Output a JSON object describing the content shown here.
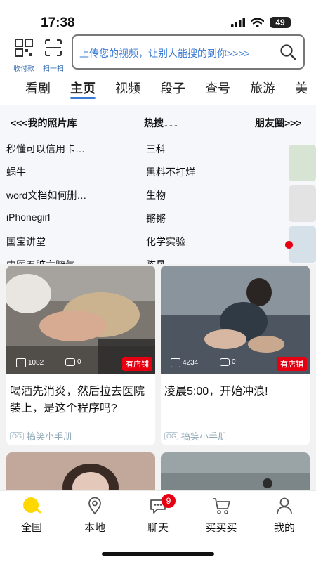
{
  "status_bar": {
    "time": "17:38",
    "battery": "49"
  },
  "top_bar": {
    "receive_pay_label": "收付款",
    "scan_label": "扫一扫",
    "search_placeholder": "上传您的视频，让别人能搜的到你>>>>"
  },
  "tabs": [
    {
      "label": "看剧",
      "active": false
    },
    {
      "label": "主页",
      "active": true
    },
    {
      "label": "视频",
      "active": false
    },
    {
      "label": "段子",
      "active": false
    },
    {
      "label": "查号",
      "active": false
    },
    {
      "label": "旅游",
      "active": false
    },
    {
      "label": "美",
      "active": false
    }
  ],
  "hot_section": {
    "left_head": "<<<我的照片库",
    "center_head": "热搜↓↓↓",
    "right_head": "朋友圈>>>",
    "left_items": [
      "秒懂可以信用卡…",
      "蜗牛",
      "word文档如何删…",
      "iPhonegirl",
      "国宝讲堂",
      "中医五脏六腑气…"
    ],
    "right_items": [
      "三科",
      "黑料不打烊",
      "生物",
      "锵锵",
      "化学实验",
      "陈垦"
    ]
  },
  "cards": [
    {
      "likes": "1082",
      "comments": "0",
      "badge": "有店铺",
      "title": "喝酒先消炎，然后拉去医院装上，是这个程序吗?",
      "source": "搞笑小手册",
      "source_tag": "OG"
    },
    {
      "likes": "4234",
      "comments": "0",
      "badge": "有店铺",
      "title": "凌晨5:00，开始冲浪!",
      "source": "搞笑小手册",
      "source_tag": "OG"
    }
  ],
  "bottom_nav": [
    {
      "label": "全国",
      "icon": "location-dot-icon"
    },
    {
      "label": "本地",
      "icon": "map-pin-icon"
    },
    {
      "label": "聊天",
      "icon": "chat-bubble-icon",
      "badge": "9"
    },
    {
      "label": "买买买",
      "icon": "shopping-cart-icon"
    },
    {
      "label": "我的",
      "icon": "person-icon"
    }
  ],
  "colors": {
    "accent": "#3a7bd5",
    "badge_red": "#e60012",
    "home_dot": "#ffd800"
  }
}
